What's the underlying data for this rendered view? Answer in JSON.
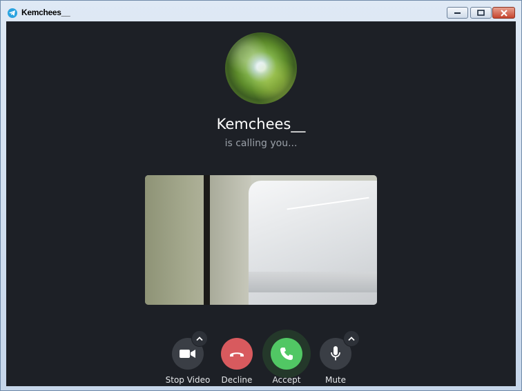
{
  "window": {
    "title": "Kemchees__"
  },
  "call": {
    "caller_name": "Kemchees__",
    "status": "is calling you..."
  },
  "controls": {
    "stop_video": "Stop Video",
    "decline": "Decline",
    "accept": "Accept",
    "mute": "Mute"
  },
  "colors": {
    "background": "#1d2026",
    "decline": "#d85a5e",
    "accept": "#51c764",
    "neutral_button": "#3a3e45"
  },
  "icons": {
    "app": "telegram-icon",
    "video": "video-camera-icon",
    "decline": "phone-hangup-icon",
    "accept": "phone-icon",
    "mute": "microphone-icon",
    "expand": "chevron-up-icon"
  }
}
